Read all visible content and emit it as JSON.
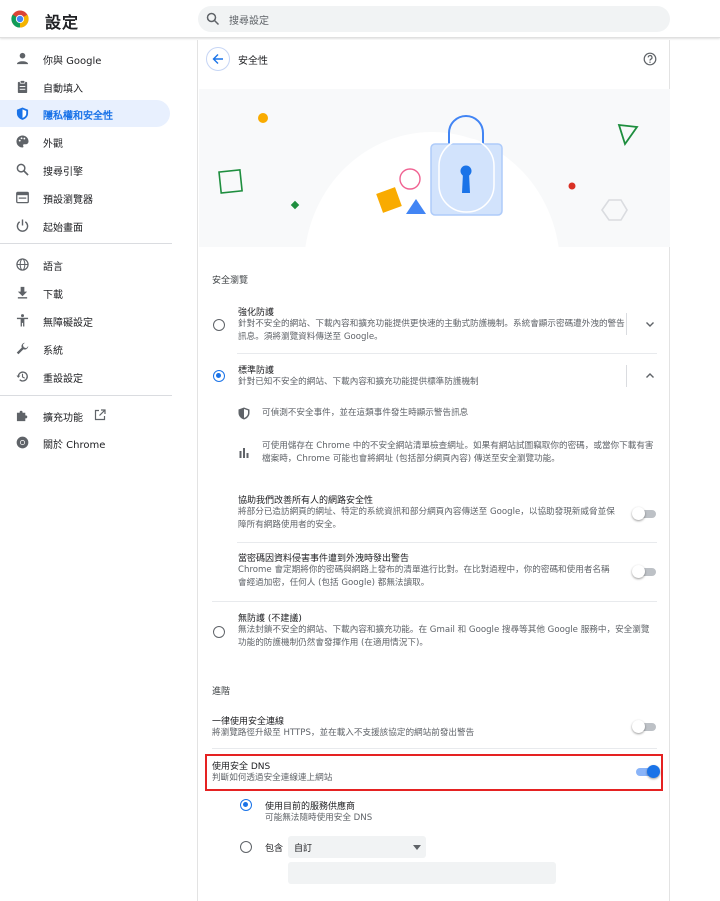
{
  "header": {
    "app_title": "設定",
    "search_placeholder": "搜尋設定"
  },
  "sidebar": {
    "items": [
      {
        "label": "你與 Google",
        "icon": "person-icon"
      },
      {
        "label": "自動填入",
        "icon": "clipboard-icon"
      },
      {
        "label": "隱私權和安全性",
        "icon": "shield-icon",
        "active": true
      },
      {
        "label": "外觀",
        "icon": "palette-icon"
      },
      {
        "label": "搜尋引擎",
        "icon": "search-icon"
      },
      {
        "label": "預設瀏覽器",
        "icon": "browser-icon"
      },
      {
        "label": "起始畫面",
        "icon": "power-icon"
      },
      {
        "label": "語言",
        "icon": "globe-icon"
      },
      {
        "label": "下載",
        "icon": "download-icon"
      },
      {
        "label": "無障礙設定",
        "icon": "accessibility-icon"
      },
      {
        "label": "系統",
        "icon": "wrench-icon"
      },
      {
        "label": "重設設定",
        "icon": "restore-icon"
      },
      {
        "label": "擴充功能",
        "icon": "puzzle-icon"
      },
      {
        "label": "關於 Chrome",
        "icon": "chrome-icon"
      }
    ]
  },
  "page": {
    "title": "安全性",
    "safe_browsing": {
      "section_title": "安全瀏覽",
      "enhanced": {
        "title": "強化防護",
        "desc": "針對不安全的網站、下載內容和擴充功能提供更快速的主動式防護機制。系統會顯示密碼遭外洩的警告訊息。須將瀏覽資料傳送至 Google。"
      },
      "standard": {
        "title": "標準防護",
        "desc": "針對已知不安全的網站、下載內容和擴充功能提供標準防護機制",
        "bullet1": "可偵測不安全事件，並在這類事件發生時顯示警告訊息",
        "bullet2": "可使用儲存在 Chrome 中的不安全網站清單檢查網址。如果有網站試圖竊取你的密碼，或當你下載有害檔案時，Chrome 可能也會將網址 (包括部分網頁內容) 傳送至安全瀏覽功能。"
      },
      "help_improve": {
        "title": "協助我們改善所有人的網路安全性",
        "desc": "將部分已造訪網頁的網址、特定的系統資訊和部分網頁內容傳送至 Google，以協助發現新威脅並保障所有網路使用者的安全。",
        "enabled": false
      },
      "password_leak": {
        "title": "當密碼因資料侵害事件遭到外洩時發出警告",
        "desc": "Chrome 會定期將你的密碼與網路上發布的清單進行比對。在比對過程中，你的密碼和使用者名稱會經過加密，任何人 (包括 Google) 都無法讀取。",
        "enabled": false
      },
      "no_protection": {
        "title": "無防護 (不建議)",
        "desc": "無法封鎖不安全的網站、下載內容和擴充功能。在 Gmail 和 Google 搜尋等其他 Google 服務中，安全瀏覽功能的防護機制仍然會發揮作用 (在適用情況下)。"
      },
      "selected": "standard"
    },
    "advanced": {
      "section_title": "進階",
      "https": {
        "title": "一律使用安全連線",
        "desc": "將瀏覽路徑升級至 HTTPS，並在載入不支援該協定的網站前發出警告",
        "enabled": false
      },
      "secure_dns": {
        "title": "使用安全 DNS",
        "desc": "判斷如何透過安全連線連上網站",
        "enabled": true,
        "option_current": "使用目前的服務供應商",
        "option_current_desc": "可能無法隨時使用安全 DNS",
        "option_with_label": "包含",
        "select_value": "自訂",
        "selected": "current"
      }
    }
  },
  "colors": {
    "accent": "#1a73e8",
    "highlight_box": "#e52222"
  }
}
